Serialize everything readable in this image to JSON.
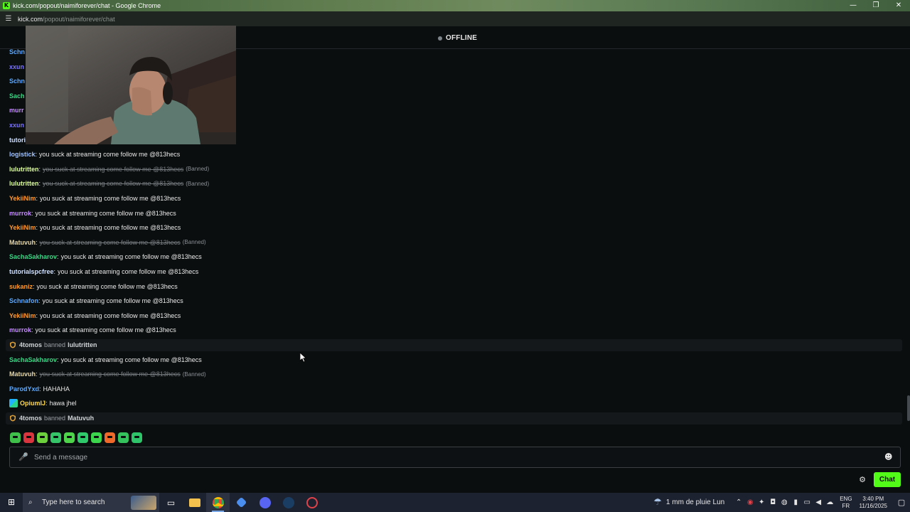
{
  "window": {
    "title": "kick.com/popout/naimiforever/chat - Google Chrome",
    "favicon": "K",
    "minimize": "—",
    "restore": "❐",
    "close": "✕"
  },
  "address_bar": {
    "host": "kick.com",
    "path": "/popout/naimiforever/chat"
  },
  "stream": {
    "status": "OFFLINE"
  },
  "chat": {
    "partial_names": [
      {
        "text": "Schn",
        "color": "#5aa9ff"
      },
      {
        "text": "xxun",
        "color": "#7b74ff"
      },
      {
        "text": "Schn",
        "color": "#5aa9ff"
      },
      {
        "text": "Sach",
        "color": "#3ad686"
      },
      {
        "text": "murr",
        "color": "#c58cff"
      },
      {
        "text": "xxun",
        "color": "#7b74ff"
      },
      {
        "text": "tutori",
        "color": "#cfe0ff"
      }
    ],
    "messages": [
      {
        "user": "logistick",
        "color": "#9fc2ff",
        "text": "you suck at streaming come follow me @813hecs",
        "banned": false
      },
      {
        "user": "lulutritten",
        "color": "#dfff9f",
        "text": "you suck at streaming come follow me @813hecs",
        "banned": true,
        "tag": "(Banned)"
      },
      {
        "user": "lulutritten",
        "color": "#dfff9f",
        "text": "you suck at streaming come follow me @813hecs",
        "banned": true,
        "tag": "(Banned)"
      },
      {
        "user": "YekiiNim",
        "color": "#ff9b2e",
        "text": "you suck at streaming come follow me @813hecs",
        "banned": false
      },
      {
        "user": "murrok",
        "color": "#c58cff",
        "text": "you suck at streaming come follow me @813hecs",
        "banned": false
      },
      {
        "user": "YekiiNim",
        "color": "#ff9b2e",
        "text": "you suck at streaming come follow me @813hecs",
        "banned": false
      },
      {
        "user": "Matuvuh",
        "color": "#e6d7a8",
        "text": "you suck at streaming come follow me @813hecs",
        "banned": true,
        "tag": "(Banned)"
      },
      {
        "user": "SachaSakharov",
        "color": "#3ad686",
        "text": "you suck at streaming come follow me @813hecs",
        "banned": false
      },
      {
        "user": "tutorialspcfree",
        "color": "#cfe0ff",
        "text": "you suck at streaming come follow me @813hecs",
        "banned": false
      },
      {
        "user": "sukaniz",
        "color": "#ff9b2e",
        "text": "you suck at streaming come follow me @813hecs",
        "banned": false
      },
      {
        "user": "Schnafon",
        "color": "#5aa9ff",
        "text": "you suck at streaming come follow me @813hecs",
        "banned": false
      },
      {
        "user": "YekiiNim",
        "color": "#ff9b2e",
        "text": "you suck at streaming come follow me @813hecs",
        "banned": false
      },
      {
        "user": "murrok",
        "color": "#c58cff",
        "text": "you suck at streaming come follow me @813hecs",
        "banned": false
      }
    ],
    "mod_action_1": {
      "moderator": "4tomos",
      "action": "banned",
      "target": "lulutritten"
    },
    "messages_2": [
      {
        "user": "SachaSakharov",
        "color": "#3ad686",
        "text": "you suck at streaming come follow me @813hecs",
        "banned": false
      },
      {
        "user": "Matuvuh",
        "color": "#e6d7a8",
        "text": "you suck at streaming come follow me @813hecs",
        "banned": true,
        "tag": "(Banned)"
      },
      {
        "user": "ParodYxd",
        "color": "#5aa9ff",
        "text": "HAHAHA",
        "banned": false
      },
      {
        "user": "OpiumIJ",
        "color": "#ffd84a",
        "text": "hawa jhel",
        "banned": false
      }
    ],
    "mod_action_2": {
      "moderator": "4tomos",
      "action": "banned",
      "target": "Matuvuh"
    }
  },
  "emote_bar": [
    "emote-1",
    "emote-2",
    "emote-3",
    "emote-4",
    "emote-5",
    "emote-6",
    "emote-7",
    "emote-8",
    "emote-9",
    "emote-10"
  ],
  "input": {
    "placeholder": "Send a message",
    "mic_icon": "🎤",
    "emoji_icon": "☻"
  },
  "controls": {
    "settings_icon": "⚙",
    "chat_button": "Chat"
  },
  "taskbar": {
    "search_placeholder": "Type here to search",
    "weather": "1 mm de pluie Lun",
    "lang_top": "ENG",
    "lang_bottom": "FR",
    "time": "3:40 PM",
    "date": "11/16/2025"
  },
  "colors": {
    "accent": "#53fc18",
    "background": "#0b0e0f"
  }
}
